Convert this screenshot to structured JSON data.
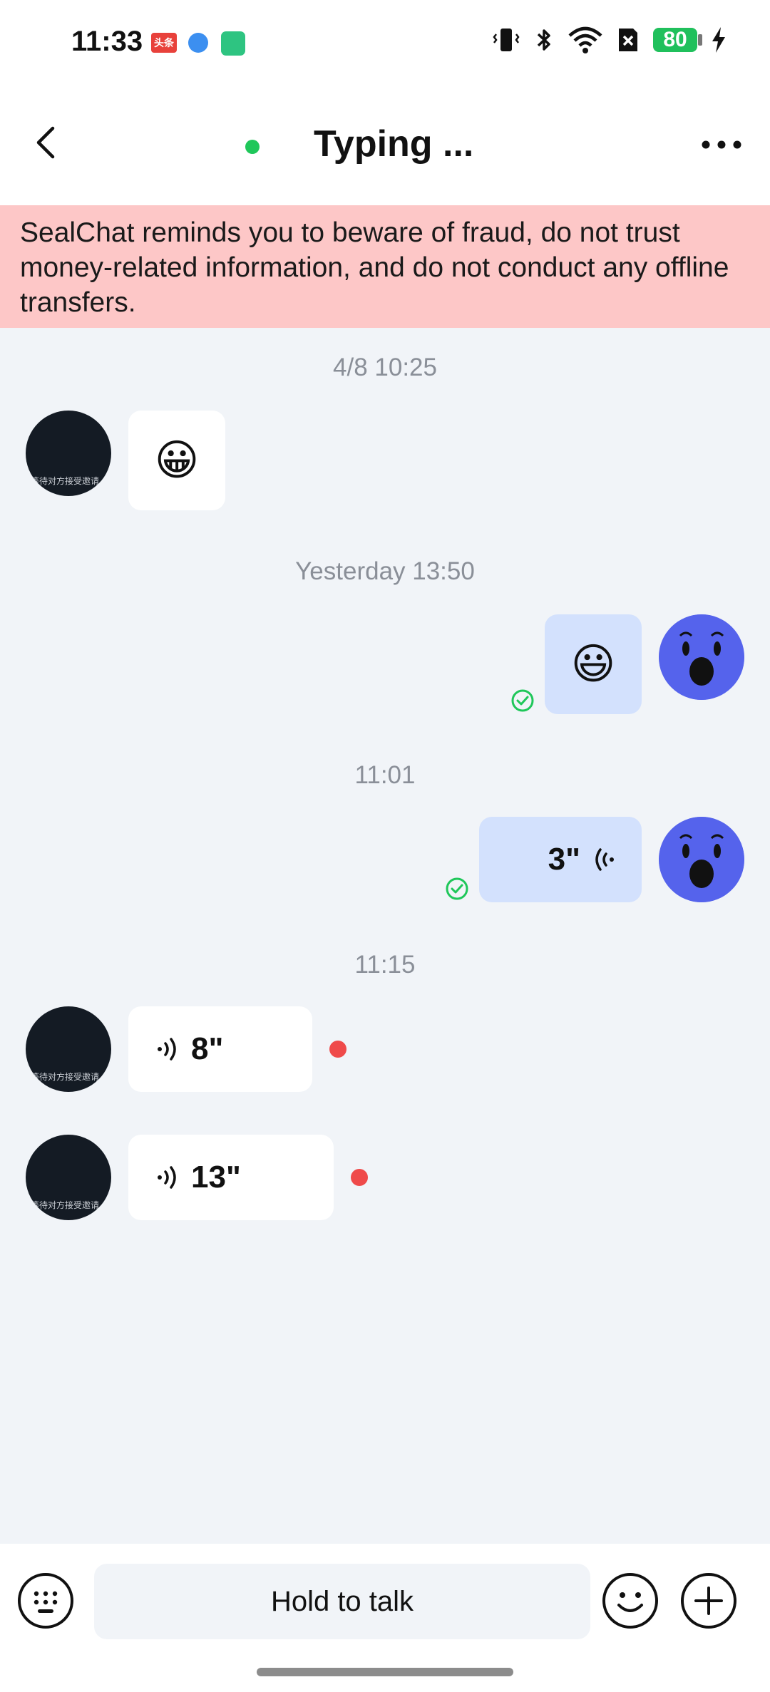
{
  "status_bar": {
    "time": "11:33",
    "app_badge_1": "头条",
    "battery_level": "80"
  },
  "header": {
    "title": "Typing ...",
    "online": true,
    "online_color": "#1fc75a"
  },
  "banner": {
    "text": "SealChat reminds you to beware of fraud, do not trust money-related information, and do not conduct any offline transfers.",
    "color": "#fdc7c7"
  },
  "messages": {
    "groups": [
      {
        "timestamp": "4/8 10:25"
      },
      {
        "timestamp": "Yesterday 13:50"
      },
      {
        "timestamp": "11:01"
      },
      {
        "timestamp": "11:15"
      }
    ],
    "items": [
      {
        "side": "in",
        "kind": "emoji",
        "content": "😀",
        "avatar_caption": "等待对方接受邀请..."
      },
      {
        "side": "out",
        "kind": "emoji",
        "content": "😃",
        "read": true
      },
      {
        "side": "out",
        "kind": "voice",
        "duration": "3\"",
        "read": true
      },
      {
        "side": "in",
        "kind": "voice",
        "duration": "8\"",
        "unread": true,
        "avatar_caption": "等待对方接受邀请..."
      },
      {
        "side": "in",
        "kind": "voice",
        "duration": "13\"",
        "unread": true,
        "avatar_caption": "等待对方接受邀请..."
      }
    ]
  },
  "input_bar": {
    "hold_to_talk_label": "Hold to talk"
  },
  "colors": {
    "outgoing_bubble": "#d3e1fd",
    "incoming_bubble": "#ffffff",
    "unread_dot": "#ef4a4a",
    "read_check": "#1fc75a",
    "self_avatar": "#5563ec"
  },
  "icons": {
    "back": "back-arrow-icon",
    "more": "more-dots-icon",
    "keyboard": "keyboard-icon",
    "emoji": "emoji-icon",
    "plus": "plus-icon",
    "voice": "voice-wave-icon",
    "read": "check-circle-icon"
  }
}
